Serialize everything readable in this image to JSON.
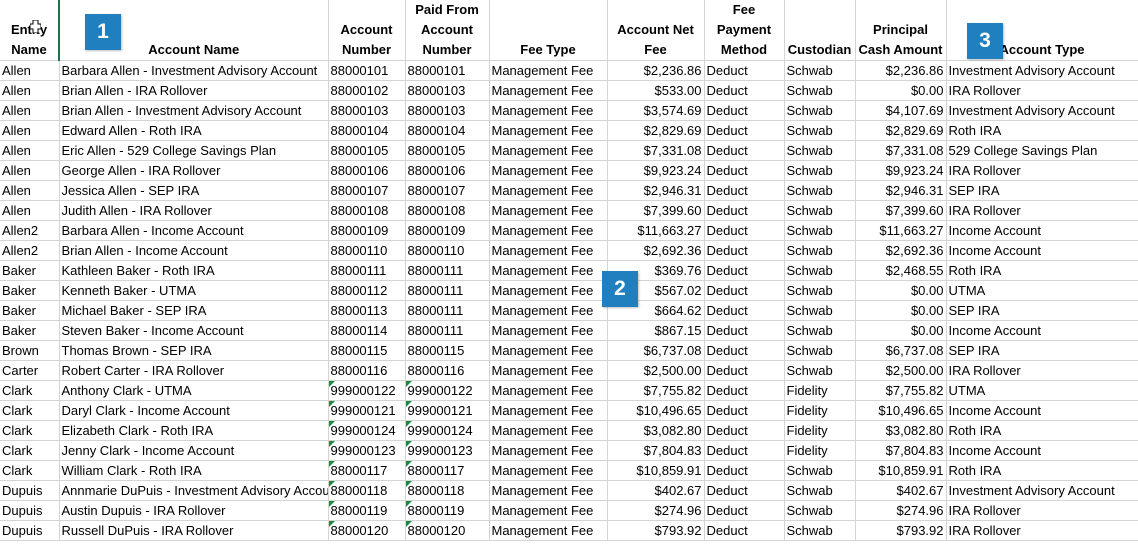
{
  "headers": {
    "entity": "Entity Name",
    "account_name": "Account Name",
    "account_number": "Account Number",
    "paid_from": "Paid From Account Number",
    "fee_type": "Fee Type",
    "net_fee": "Account Net Fee",
    "payment_method": "Fee Payment Method",
    "custodian": "Custodian",
    "principal_cash": "Principal Cash Amount",
    "account_type": "Account Type"
  },
  "badges": [
    "1",
    "2",
    "3"
  ],
  "cursor_icon": "plus-cursor-icon",
  "flag_color": "#1e8a3e",
  "badge_color": "#1f7fbf",
  "rows": [
    {
      "entity": "Allen",
      "name": "Barbara Allen - Investment Advisory Account",
      "num": "88000101",
      "paid": "88000101",
      "fee_type": "Management Fee",
      "net_fee": "$2,236.86",
      "method": "Deduct",
      "custodian": "Schwab",
      "cash": "$2,236.86",
      "type": "Investment Advisory Account"
    },
    {
      "entity": "Allen",
      "name": "Brian Allen - IRA Rollover",
      "num": "88000102",
      "paid": "88000103",
      "fee_type": "Management Fee",
      "net_fee": "$533.00",
      "method": "Deduct",
      "custodian": "Schwab",
      "cash": "$0.00",
      "type": "IRA Rollover"
    },
    {
      "entity": "Allen",
      "name": "Brian Allen - Investment Advisory Account",
      "num": "88000103",
      "paid": "88000103",
      "fee_type": "Management Fee",
      "net_fee": "$3,574.69",
      "method": "Deduct",
      "custodian": "Schwab",
      "cash": "$4,107.69",
      "type": "Investment Advisory Account"
    },
    {
      "entity": "Allen",
      "name": "Edward Allen - Roth IRA",
      "num": "88000104",
      "paid": "88000104",
      "fee_type": "Management Fee",
      "net_fee": "$2,829.69",
      "method": "Deduct",
      "custodian": "Schwab",
      "cash": "$2,829.69",
      "type": "Roth IRA"
    },
    {
      "entity": "Allen",
      "name": "Eric Allen - 529 College Savings Plan",
      "num": "88000105",
      "paid": "88000105",
      "fee_type": "Management Fee",
      "net_fee": "$7,331.08",
      "method": "Deduct",
      "custodian": "Schwab",
      "cash": "$7,331.08",
      "type": "529 College Savings Plan"
    },
    {
      "entity": "Allen",
      "name": "George Allen - IRA Rollover",
      "num": "88000106",
      "paid": "88000106",
      "fee_type": "Management Fee",
      "net_fee": "$9,923.24",
      "method": "Deduct",
      "custodian": "Schwab",
      "cash": "$9,923.24",
      "type": "IRA Rollover"
    },
    {
      "entity": "Allen",
      "name": "Jessica Allen - SEP IRA",
      "num": "88000107",
      "paid": "88000107",
      "fee_type": "Management Fee",
      "net_fee": "$2,946.31",
      "method": "Deduct",
      "custodian": "Schwab",
      "cash": "$2,946.31",
      "type": "SEP IRA"
    },
    {
      "entity": "Allen",
      "name": "Judith Allen - IRA Rollover",
      "num": "88000108",
      "paid": "88000108",
      "fee_type": "Management Fee",
      "net_fee": "$7,399.60",
      "method": "Deduct",
      "custodian": "Schwab",
      "cash": "$7,399.60",
      "type": "IRA Rollover"
    },
    {
      "entity": "Allen2",
      "name": "Barbara Allen - Income Account",
      "num": "88000109",
      "paid": "88000109",
      "fee_type": "Management Fee",
      "net_fee": "$11,663.27",
      "method": "Deduct",
      "custodian": "Schwab",
      "cash": "$11,663.27",
      "type": "Income Account"
    },
    {
      "entity": "Allen2",
      "name": "Brian Allen - Income Account",
      "num": "88000110",
      "paid": "88000110",
      "fee_type": "Management Fee",
      "net_fee": "$2,692.36",
      "method": "Deduct",
      "custodian": "Schwab",
      "cash": "$2,692.36",
      "type": "Income Account"
    },
    {
      "entity": "Baker",
      "name": "Kathleen Baker - Roth IRA",
      "num": "88000111",
      "paid": "88000111",
      "fee_type": "Management Fee",
      "net_fee": "$369.76",
      "method": "Deduct",
      "custodian": "Schwab",
      "cash": "$2,468.55",
      "type": "Roth IRA"
    },
    {
      "entity": "Baker",
      "name": "Kenneth Baker - UTMA",
      "num": "88000112",
      "paid": "88000111",
      "fee_type": "Management Fee",
      "net_fee": "$567.02",
      "method": "Deduct",
      "custodian": "Schwab",
      "cash": "$0.00",
      "type": "UTMA"
    },
    {
      "entity": "Baker",
      "name": "Michael Baker - SEP IRA",
      "num": "88000113",
      "paid": "88000111",
      "fee_type": "Management Fee",
      "net_fee": "$664.62",
      "method": "Deduct",
      "custodian": "Schwab",
      "cash": "$0.00",
      "type": "SEP IRA"
    },
    {
      "entity": "Baker",
      "name": "Steven Baker - Income Account",
      "num": "88000114",
      "paid": "88000111",
      "fee_type": "Management Fee",
      "net_fee": "$867.15",
      "method": "Deduct",
      "custodian": "Schwab",
      "cash": "$0.00",
      "type": "Income Account"
    },
    {
      "entity": "Brown",
      "name": "Thomas Brown - SEP IRA",
      "num": "88000115",
      "paid": "88000115",
      "fee_type": "Management Fee",
      "net_fee": "$6,737.08",
      "method": "Deduct",
      "custodian": "Schwab",
      "cash": "$6,737.08",
      "type": "SEP IRA"
    },
    {
      "entity": "Carter",
      "name": "Robert Carter - IRA Rollover",
      "num": "88000116",
      "paid": "88000116",
      "fee_type": "Management Fee",
      "net_fee": "$2,500.00",
      "method": "Deduct",
      "custodian": "Schwab",
      "cash": "$2,500.00",
      "type": "IRA Rollover"
    },
    {
      "entity": "Clark",
      "name": "Anthony Clark - UTMA",
      "num": "999000122",
      "paid": "999000122",
      "fee_type": "Management Fee",
      "net_fee": "$7,755.82",
      "method": "Deduct",
      "custodian": "Fidelity",
      "cash": "$7,755.82",
      "type": "UTMA",
      "flag": true
    },
    {
      "entity": "Clark",
      "name": "Daryl Clark - Income Account",
      "num": "999000121",
      "paid": "999000121",
      "fee_type": "Management Fee",
      "net_fee": "$10,496.65",
      "method": "Deduct",
      "custodian": "Fidelity",
      "cash": "$10,496.65",
      "type": "Income Account",
      "flag": true
    },
    {
      "entity": "Clark",
      "name": "Elizabeth Clark - Roth IRA",
      "num": "999000124",
      "paid": "999000124",
      "fee_type": "Management Fee",
      "net_fee": "$3,082.80",
      "method": "Deduct",
      "custodian": "Fidelity",
      "cash": "$3,082.80",
      "type": "Roth IRA",
      "flag": true
    },
    {
      "entity": "Clark",
      "name": "Jenny Clark - Income Account",
      "num": "999000123",
      "paid": "999000123",
      "fee_type": "Management Fee",
      "net_fee": "$7,804.83",
      "method": "Deduct",
      "custodian": "Fidelity",
      "cash": "$7,804.83",
      "type": "Income Account",
      "flag": true
    },
    {
      "entity": "Clark",
      "name": "William Clark - Roth IRA",
      "num": "88000117",
      "paid": "88000117",
      "fee_type": "Management Fee",
      "net_fee": "$10,859.91",
      "method": "Deduct",
      "custodian": "Schwab",
      "cash": "$10,859.91",
      "type": "Roth IRA",
      "flag": true
    },
    {
      "entity": "Dupuis",
      "name": "Annmarie DuPuis - Investment Advisory Account",
      "num": "88000118",
      "paid": "88000118",
      "fee_type": "Management Fee",
      "net_fee": "$402.67",
      "method": "Deduct",
      "custodian": "Schwab",
      "cash": "$402.67",
      "type": "Investment Advisory Account",
      "flag": true
    },
    {
      "entity": "Dupuis",
      "name": "Austin Dupuis - IRA Rollover",
      "num": "88000119",
      "paid": "88000119",
      "fee_type": "Management Fee",
      "net_fee": "$274.96",
      "method": "Deduct",
      "custodian": "Schwab",
      "cash": "$274.96",
      "type": "IRA Rollover",
      "flag": true
    },
    {
      "entity": "Dupuis",
      "name": "Russell DuPuis - IRA Rollover",
      "num": "88000120",
      "paid": "88000120",
      "fee_type": "Management Fee",
      "net_fee": "$793.92",
      "method": "Deduct",
      "custodian": "Schwab",
      "cash": "$793.92",
      "type": "IRA Rollover",
      "flag": true
    }
  ]
}
